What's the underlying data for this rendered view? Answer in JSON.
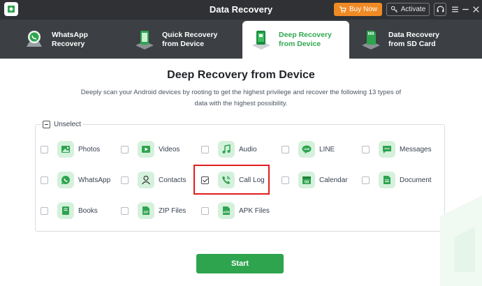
{
  "window": {
    "title": "Data Recovery",
    "buy_label": "Buy Now",
    "activate_label": "Activate"
  },
  "tabs": [
    {
      "label_line1": "WhatsApp",
      "label_line2": "Recovery",
      "icon": "whatsapp-recovery-icon",
      "active": false
    },
    {
      "label_line1": "Quick Recovery",
      "label_line2": "from Device",
      "icon": "quick-recovery-icon",
      "active": false
    },
    {
      "label_line1": "Deep Recovery",
      "label_line2": "from Device",
      "icon": "deep-recovery-icon",
      "active": true
    },
    {
      "label_line1": "Data Recovery",
      "label_line2": "from SD Card",
      "icon": "sd-card-icon",
      "active": false
    }
  ],
  "main": {
    "title": "Deep Recovery from Device",
    "description": "Deeply scan your Android devices by rooting to get the highest privilege and recover the following 13 types of data with the highest possibility."
  },
  "selection": {
    "unselect_label": "Unselect"
  },
  "data_types": [
    {
      "label": "Photos",
      "icon": "photo-icon",
      "checked": false
    },
    {
      "label": "Videos",
      "icon": "video-icon",
      "checked": false
    },
    {
      "label": "Audio",
      "icon": "music-note-icon",
      "checked": false
    },
    {
      "label": "LINE",
      "icon": "line-app-icon",
      "checked": false
    },
    {
      "label": "Messages",
      "icon": "message-bubble-icon",
      "checked": false
    },
    {
      "label": "WhatsApp",
      "icon": "whatsapp-icon",
      "checked": false
    },
    {
      "label": "Contacts",
      "icon": "contact-person-icon",
      "checked": false
    },
    {
      "label": "Call Log",
      "icon": "phone-call-icon",
      "checked": true
    },
    {
      "label": "Calendar",
      "icon": "calendar-icon",
      "checked": false
    },
    {
      "label": "Document",
      "icon": "document-icon",
      "checked": false
    },
    {
      "label": "Books",
      "icon": "book-icon",
      "checked": false
    },
    {
      "label": "ZIP Files",
      "icon": "zip-file-icon",
      "checked": false
    },
    {
      "label": "APK Files",
      "icon": "apk-file-icon",
      "checked": false
    }
  ],
  "icon_text": {
    "line": "LINE",
    "calendar": "03",
    "zip": "ZIP",
    "apk": "APK"
  },
  "actions": {
    "start_label": "Start"
  },
  "colors": {
    "accent_green": "#2ea44f",
    "icon_bg": "#d5f1dc",
    "buy_orange": "#f08a24",
    "titlebar": "#2f3134",
    "tabbar": "#3c3f43",
    "highlight_red": "#e11d1d"
  }
}
